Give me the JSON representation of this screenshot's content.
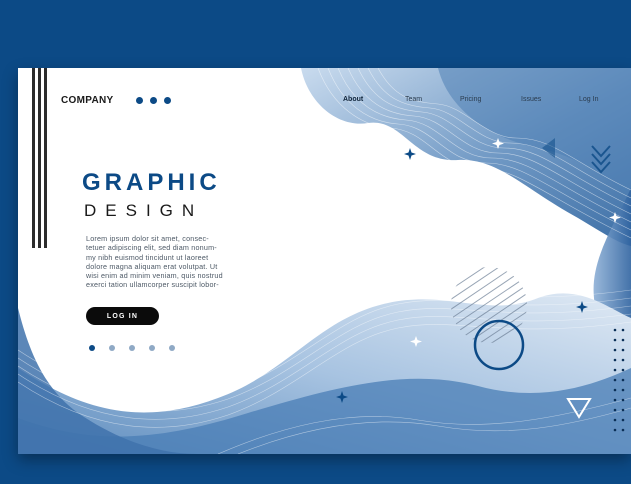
{
  "header": {
    "brand": "COMPANY",
    "nav": [
      {
        "label": "About",
        "active": true
      },
      {
        "label": "Team",
        "active": false
      },
      {
        "label": "Pricing",
        "active": false
      },
      {
        "label": "Issues",
        "active": false
      },
      {
        "label": "Log In",
        "active": false
      }
    ]
  },
  "hero": {
    "title": "GRAPHIC",
    "subtitle": "DESIGN",
    "body_lines": [
      "Lorem ipsum dolor sit amet, consec-",
      "tetuer adipiscing elit, sed diam nonum-",
      "my nibh euismod tincidunt ut laoreet",
      "dolore magna aliquam erat volutpat. Ut",
      "wisi enim ad minim veniam, quis nostrud",
      "exerci tation ullamcorper suscipit lobor-"
    ],
    "cta_label": "LOG IN"
  },
  "slider": {
    "count": 5,
    "active_index": 0
  },
  "colors": {
    "background": "#0c4a86",
    "accent": "#0c4a86",
    "wave_light": "#b9d0e8",
    "wave_mid": "#6d97c2",
    "button": "#0b0b0b"
  },
  "icons": [
    "chevron-down-icon",
    "triangle-outline-icon",
    "plus-sparkle-icon",
    "circle-outline-icon",
    "striped-circle-icon",
    "dot-grid-icon"
  ]
}
